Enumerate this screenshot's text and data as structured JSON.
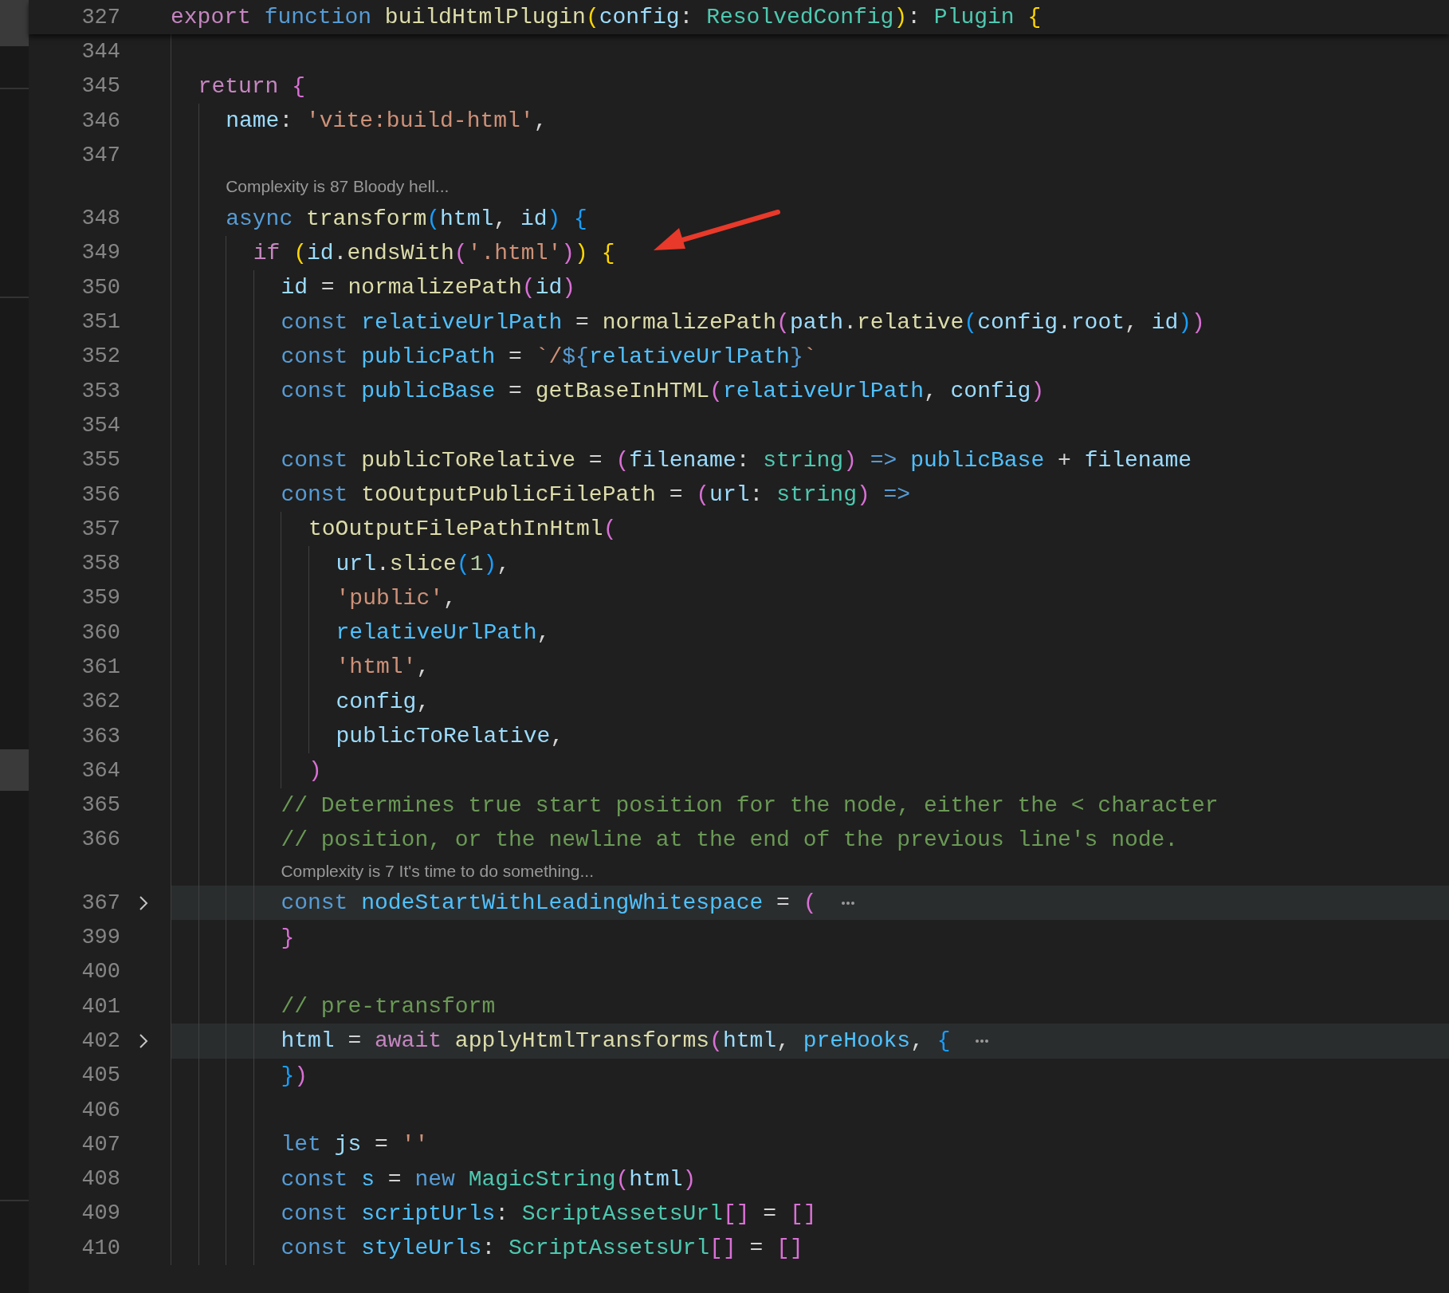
{
  "sticky_line": {
    "number": "327",
    "tokens": [
      {
        "text": "export",
        "kind": "kw"
      },
      {
        "text": " function",
        "kind": "storage"
      },
      {
        "text": " buildHtmlPlugin",
        "kind": "fn"
      },
      {
        "text": "(",
        "kind": "b1"
      },
      {
        "text": "config",
        "kind": "var"
      },
      {
        "text": ": "
      },
      {
        "text": "ResolvedConfig",
        "kind": "type"
      },
      {
        "text": ")",
        "kind": "b1"
      },
      {
        "text": ": "
      },
      {
        "text": "Plugin",
        "kind": "type"
      },
      {
        "text": " {",
        "kind": "b1"
      }
    ],
    "children": [
      {
        "kind": "code",
        "number": "344",
        "folded": false
      },
      {
        "kind": "code",
        "number": "345",
        "folded": false,
        "tokens": [
          {
            "text": "return",
            "kind": "kw"
          },
          {
            "text": " {",
            "kind": "b2"
          }
        ],
        "children": [
          {
            "kind": "code",
            "number": "346",
            "folded": false,
            "tokens": [
              {
                "text": "name",
                "kind": "var"
              },
              {
                "text": ": "
              },
              {
                "text": "'vite:build-html'",
                "kind": "str"
              },
              {
                "text": ","
              }
            ]
          },
          {
            "kind": "code",
            "number": "347",
            "folded": false
          },
          {
            "kind": "codelens",
            "text": "Complexity is 87 Bloody hell..."
          },
          {
            "kind": "code",
            "number": "348",
            "folded": false,
            "tokens": [
              {
                "text": "async",
                "kind": "storage"
              },
              {
                "text": " transform",
                "kind": "fn"
              },
              {
                "text": "(",
                "kind": "b3"
              },
              {
                "text": "html",
                "kind": "var"
              },
              {
                "text": ", "
              },
              {
                "text": "id",
                "kind": "var"
              },
              {
                "text": ")",
                "kind": "b3"
              },
              {
                "text": " {",
                "kind": "b3"
              }
            ],
            "children": [
              {
                "kind": "code",
                "number": "349",
                "folded": false,
                "tokens": [
                  {
                    "text": "if",
                    "kind": "kw"
                  },
                  {
                    "text": " (",
                    "kind": "b1"
                  },
                  {
                    "text": "id",
                    "kind": "var"
                  },
                  {
                    "text": "."
                  },
                  {
                    "text": "endsWith",
                    "kind": "fn"
                  },
                  {
                    "text": "(",
                    "kind": "b2"
                  },
                  {
                    "text": "'.html'",
                    "kind": "str"
                  },
                  {
                    "text": ")",
                    "kind": "b2"
                  },
                  {
                    "text": ")",
                    "kind": "b1"
                  },
                  {
                    "text": " {",
                    "kind": "b1"
                  }
                ],
                "children": [
                  {
                    "kind": "code",
                    "number": "350",
                    "folded": false,
                    "tokens": [
                      {
                        "text": "id",
                        "kind": "var"
                      },
                      {
                        "text": " = "
                      },
                      {
                        "text": "normalizePath",
                        "kind": "fn"
                      },
                      {
                        "text": "(",
                        "kind": "b2"
                      },
                      {
                        "text": "id",
                        "kind": "var"
                      },
                      {
                        "text": ")",
                        "kind": "b2"
                      }
                    ]
                  },
                  {
                    "kind": "code",
                    "number": "351",
                    "folded": false,
                    "tokens": [
                      {
                        "text": "const",
                        "kind": "storage"
                      },
                      {
                        "text": " relativeUrlPath",
                        "kind": "const"
                      },
                      {
                        "text": " = "
                      },
                      {
                        "text": "normalizePath",
                        "kind": "fn"
                      },
                      {
                        "text": "(",
                        "kind": "b2"
                      },
                      {
                        "text": "path",
                        "kind": "var"
                      },
                      {
                        "text": "."
                      },
                      {
                        "text": "relative",
                        "kind": "fn"
                      },
                      {
                        "text": "(",
                        "kind": "b3"
                      },
                      {
                        "text": "config",
                        "kind": "var"
                      },
                      {
                        "text": "."
                      },
                      {
                        "text": "root",
                        "kind": "var"
                      },
                      {
                        "text": ", "
                      },
                      {
                        "text": "id",
                        "kind": "var"
                      },
                      {
                        "text": ")",
                        "kind": "b3"
                      },
                      {
                        "text": ")",
                        "kind": "b2"
                      }
                    ]
                  },
                  {
                    "kind": "code",
                    "number": "352",
                    "folded": false,
                    "tokens": [
                      {
                        "text": "const",
                        "kind": "storage"
                      },
                      {
                        "text": " publicPath",
                        "kind": "const"
                      },
                      {
                        "text": " = "
                      },
                      {
                        "text": "`/",
                        "kind": "str"
                      },
                      {
                        "text": "${",
                        "kind": "storage"
                      },
                      {
                        "text": "relativeUrlPath",
                        "kind": "const"
                      },
                      {
                        "text": "}",
                        "kind": "storage"
                      },
                      {
                        "text": "`",
                        "kind": "str"
                      }
                    ]
                  },
                  {
                    "kind": "code",
                    "number": "353",
                    "folded": false,
                    "tokens": [
                      {
                        "text": "const",
                        "kind": "storage"
                      },
                      {
                        "text": " publicBase",
                        "kind": "const"
                      },
                      {
                        "text": " = "
                      },
                      {
                        "text": "getBaseInHTML",
                        "kind": "fn"
                      },
                      {
                        "text": "(",
                        "kind": "b2"
                      },
                      {
                        "text": "relativeUrlPath",
                        "kind": "const"
                      },
                      {
                        "text": ", "
                      },
                      {
                        "text": "config",
                        "kind": "var"
                      },
                      {
                        "text": ")",
                        "kind": "b2"
                      }
                    ]
                  },
                  {
                    "kind": "code",
                    "number": "354",
                    "folded": false
                  },
                  {
                    "kind": "code",
                    "number": "355",
                    "folded": false,
                    "tokens": [
                      {
                        "text": "const",
                        "kind": "storage"
                      },
                      {
                        "text": " publicToRelative",
                        "kind": "fn"
                      },
                      {
                        "text": " = "
                      },
                      {
                        "text": "(",
                        "kind": "b2"
                      },
                      {
                        "text": "filename",
                        "kind": "var"
                      },
                      {
                        "text": ": "
                      },
                      {
                        "text": "string",
                        "kind": "type"
                      },
                      {
                        "text": ")",
                        "kind": "b2"
                      },
                      {
                        "text": " =>",
                        "kind": "storage"
                      },
                      {
                        "text": " publicBase",
                        "kind": "const"
                      },
                      {
                        "text": " + "
                      },
                      {
                        "text": "filename",
                        "kind": "var"
                      }
                    ]
                  },
                  {
                    "kind": "code",
                    "number": "356",
                    "folded": false,
                    "tokens": [
                      {
                        "text": "const",
                        "kind": "storage"
                      },
                      {
                        "text": " toOutputPublicFilePath",
                        "kind": "fn"
                      },
                      {
                        "text": " = "
                      },
                      {
                        "text": "(",
                        "kind": "b2"
                      },
                      {
                        "text": "url",
                        "kind": "var"
                      },
                      {
                        "text": ": "
                      },
                      {
                        "text": "string",
                        "kind": "type"
                      },
                      {
                        "text": ")",
                        "kind": "b2"
                      },
                      {
                        "text": " =>",
                        "kind": "storage"
                      }
                    ],
                    "children": [
                      {
                        "kind": "code",
                        "number": "357",
                        "folded": false,
                        "tokens": [
                          {
                            "text": "toOutputFilePathInHtml",
                            "kind": "fn"
                          },
                          {
                            "text": "(",
                            "kind": "b2"
                          }
                        ],
                        "children": [
                          {
                            "kind": "code",
                            "number": "358",
                            "folded": false,
                            "tokens": [
                              {
                                "text": "url",
                                "kind": "var"
                              },
                              {
                                "text": "."
                              },
                              {
                                "text": "slice",
                                "kind": "fn"
                              },
                              {
                                "text": "(",
                                "kind": "b3"
                              },
                              {
                                "text": "1",
                                "kind": "num"
                              },
                              {
                                "text": ")",
                                "kind": "b3"
                              },
                              {
                                "text": ","
                              }
                            ]
                          },
                          {
                            "kind": "code",
                            "number": "359",
                            "folded": false,
                            "tokens": [
                              {
                                "text": "'public'",
                                "kind": "str"
                              },
                              {
                                "text": ","
                              }
                            ]
                          },
                          {
                            "kind": "code",
                            "number": "360",
                            "folded": false,
                            "tokens": [
                              {
                                "text": "relativeUrlPath",
                                "kind": "const"
                              },
                              {
                                "text": ","
                              }
                            ]
                          },
                          {
                            "kind": "code",
                            "number": "361",
                            "folded": false,
                            "tokens": [
                              {
                                "text": "'html'",
                                "kind": "str"
                              },
                              {
                                "text": ","
                              }
                            ]
                          },
                          {
                            "kind": "code",
                            "number": "362",
                            "folded": false,
                            "tokens": [
                              {
                                "text": "config",
                                "kind": "var"
                              },
                              {
                                "text": ","
                              }
                            ]
                          },
                          {
                            "kind": "code",
                            "number": "363",
                            "folded": false,
                            "tokens": [
                              {
                                "text": "publicToRelative",
                                "kind": "var"
                              },
                              {
                                "text": ","
                              }
                            ]
                          }
                        ]
                      },
                      {
                        "kind": "code",
                        "number": "364",
                        "folded": false,
                        "tokens": [
                          {
                            "text": ")",
                            "kind": "b2"
                          }
                        ]
                      }
                    ]
                  },
                  {
                    "kind": "code",
                    "number": "365",
                    "folded": false,
                    "tokens": [
                      {
                        "text": "// Determines true start position for the node, either the < character",
                        "kind": "comment"
                      }
                    ]
                  },
                  {
                    "kind": "code",
                    "number": "366",
                    "folded": false,
                    "tokens": [
                      {
                        "text": "// position, or the newline at the end of the previous line's node.",
                        "kind": "comment"
                      }
                    ]
                  },
                  {
                    "kind": "codelens",
                    "text": "Complexity is 7 It's time to do something..."
                  },
                  {
                    "kind": "code",
                    "number": "367",
                    "folded": true,
                    "tokens": [
                      {
                        "text": "const",
                        "kind": "storage"
                      },
                      {
                        "text": " nodeStartWithLeadingWhitespace",
                        "kind": "const"
                      },
                      {
                        "text": " = "
                      },
                      {
                        "text": "(",
                        "kind": "b2"
                      }
                    ]
                  },
                  {
                    "kind": "code",
                    "number": "399",
                    "folded": false,
                    "tokens": [
                      {
                        "text": "}",
                        "kind": "b2"
                      }
                    ]
                  },
                  {
                    "kind": "code",
                    "number": "400",
                    "folded": false
                  },
                  {
                    "kind": "code",
                    "number": "401",
                    "folded": false,
                    "tokens": [
                      {
                        "text": "// pre-transform",
                        "kind": "comment"
                      }
                    ]
                  },
                  {
                    "kind": "code",
                    "number": "402",
                    "folded": true,
                    "tokens": [
                      {
                        "text": "html",
                        "kind": "var"
                      },
                      {
                        "text": " = "
                      },
                      {
                        "text": "await",
                        "kind": "kw"
                      },
                      {
                        "text": " applyHtmlTransforms",
                        "kind": "fn"
                      },
                      {
                        "text": "(",
                        "kind": "b2"
                      },
                      {
                        "text": "html",
                        "kind": "var"
                      },
                      {
                        "text": ", "
                      },
                      {
                        "text": "preHooks",
                        "kind": "const"
                      },
                      {
                        "text": ", "
                      },
                      {
                        "text": "{",
                        "kind": "b3"
                      }
                    ]
                  },
                  {
                    "kind": "code",
                    "number": "405",
                    "folded": false,
                    "tokens": [
                      {
                        "text": "}",
                        "kind": "b3"
                      },
                      {
                        "text": ")",
                        "kind": "b2"
                      }
                    ]
                  },
                  {
                    "kind": "code",
                    "number": "406",
                    "folded": false
                  },
                  {
                    "kind": "code",
                    "number": "407",
                    "folded": false,
                    "tokens": [
                      {
                        "text": "let",
                        "kind": "storage"
                      },
                      {
                        "text": " js",
                        "kind": "var"
                      },
                      {
                        "text": " = "
                      },
                      {
                        "text": "''",
                        "kind": "str"
                      }
                    ]
                  },
                  {
                    "kind": "code",
                    "number": "408",
                    "folded": false,
                    "tokens": [
                      {
                        "text": "const",
                        "kind": "storage"
                      },
                      {
                        "text": " s",
                        "kind": "const"
                      },
                      {
                        "text": " = "
                      },
                      {
                        "text": "new",
                        "kind": "storage"
                      },
                      {
                        "text": " MagicString",
                        "kind": "type"
                      },
                      {
                        "text": "(",
                        "kind": "b2"
                      },
                      {
                        "text": "html",
                        "kind": "var"
                      },
                      {
                        "text": ")",
                        "kind": "b2"
                      }
                    ]
                  },
                  {
                    "kind": "code",
                    "number": "409",
                    "folded": false,
                    "tokens": [
                      {
                        "text": "const",
                        "kind": "storage"
                      },
                      {
                        "text": " scriptUrls",
                        "kind": "const"
                      },
                      {
                        "text": ": "
                      },
                      {
                        "text": "ScriptAssetsUrl",
                        "kind": "type"
                      },
                      {
                        "text": "[]",
                        "kind": "b2"
                      },
                      {
                        "text": " = "
                      },
                      {
                        "text": "[]",
                        "kind": "b2"
                      }
                    ]
                  },
                  {
                    "kind": "code",
                    "number": "410",
                    "folded": false,
                    "tokens": [
                      {
                        "text": "const",
                        "kind": "storage"
                      },
                      {
                        "text": " styleUrls",
                        "kind": "const"
                      },
                      {
                        "text": ": "
                      },
                      {
                        "text": "ScriptAssetsUrl",
                        "kind": "type"
                      },
                      {
                        "text": "[]",
                        "kind": "b2"
                      },
                      {
                        "text": " = "
                      },
                      {
                        "text": "[]",
                        "kind": "b2"
                      }
                    ]
                  }
                ]
              }
            ]
          }
        ]
      }
    ]
  }
}
